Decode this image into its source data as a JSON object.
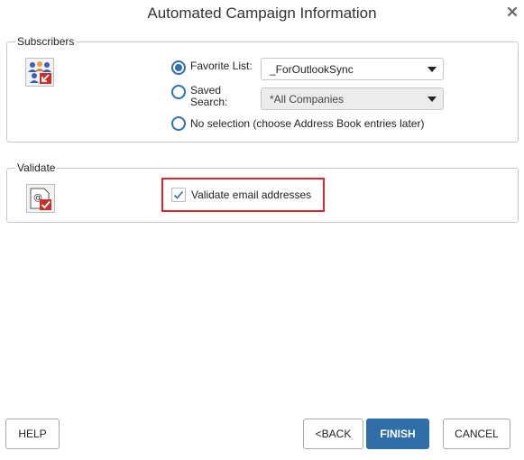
{
  "dialog": {
    "title": "Automated Campaign Information"
  },
  "subscribers": {
    "legend": "Subscribers",
    "icon": "people-group-icon",
    "options": [
      {
        "label": "Favorite List:",
        "selected": true
      },
      {
        "label": "Saved\nSearch:",
        "selected": false
      },
      {
        "label": "No selection (choose Address Book entries later)",
        "selected": false
      }
    ],
    "favorite_list_value": "_ForOutlookSync",
    "saved_search_value": "*All Companies"
  },
  "validate": {
    "legend": "Validate",
    "icon": "email-check-icon",
    "checkbox_label": "Validate email addresses",
    "checked": true
  },
  "buttons": {
    "help": "HELP",
    "back": "<BACK",
    "finish": "FINISH",
    "cancel": "CANCEL"
  },
  "colors": {
    "accent": "#2f6ea8",
    "highlight": "#d7262e"
  }
}
